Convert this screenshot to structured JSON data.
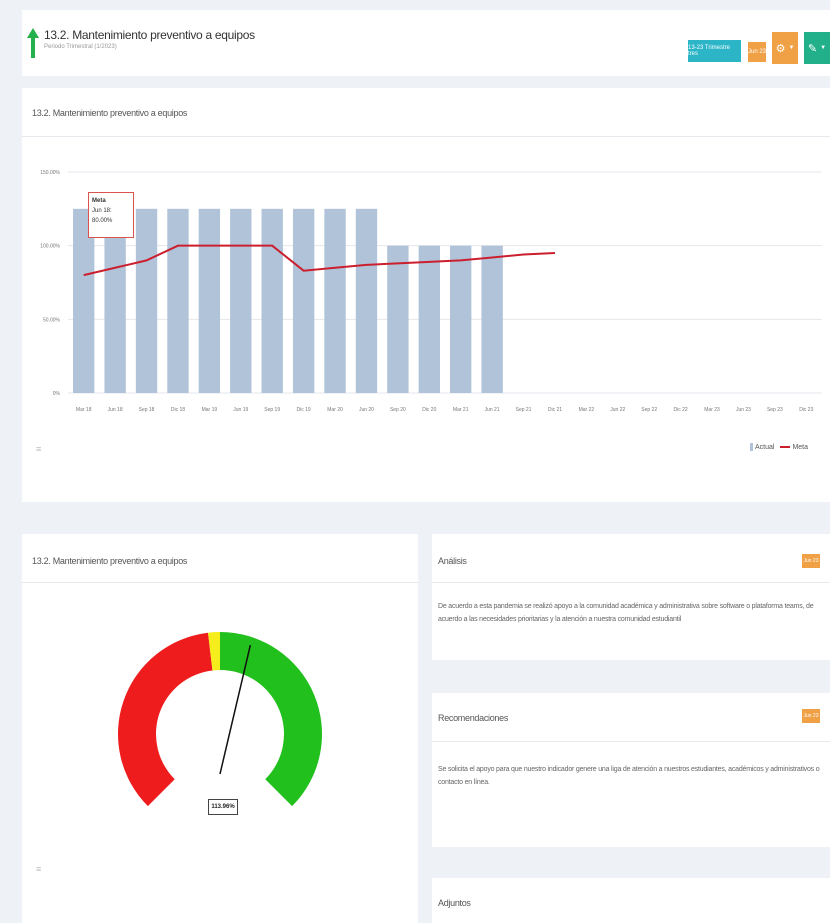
{
  "header": {
    "title": "13.2. Mantenimiento preventivo a equipos",
    "subtitle": "Periodo Trimestral (1/2023)",
    "period_button": "13-23 Trimestre tres",
    "lock_button": "Jun 23",
    "gear_icon": "gear-icon",
    "edit_icon": "pencil-icon",
    "accent_period": "#2bb5c7",
    "accent_orange": "#f0a045",
    "accent_green": "#22b08a"
  },
  "chart_card": {
    "title": "13.2. Mantenimiento preventivo a equipos",
    "legend": {
      "actual": "Actual",
      "meta": "Meta"
    },
    "tooltip": {
      "label": "Meta",
      "value": "Jun 18: 80.00%"
    }
  },
  "chart_data": {
    "type": "bar",
    "categories": [
      "Mar 18",
      "Jun 18",
      "Sep 18",
      "Dic 18",
      "Mar 19",
      "Jun 19",
      "Sep 19",
      "Dic 19",
      "Mar 20",
      "Jun 20",
      "Sep 20",
      "Dic 20",
      "Mar 21",
      "Jun 21",
      "Sep 21",
      "Dic 21",
      "Mar 22",
      "Jun 22",
      "Sep 22",
      "Dic 22",
      "Mar 23",
      "Jun 23",
      "Sep 23",
      "Dic 23"
    ],
    "series": [
      {
        "name": "Actual",
        "type": "bar",
        "color": "#b0c3d9",
        "values": [
          125,
          125,
          125,
          125,
          125,
          125,
          125,
          125,
          125,
          125,
          100,
          100,
          100,
          100,
          null,
          null,
          null,
          null,
          null,
          null,
          null,
          null,
          null,
          null
        ]
      },
      {
        "name": "Meta",
        "type": "line",
        "color": "#cc1f2e",
        "values": [
          80,
          85,
          90,
          100,
          100,
          100,
          100,
          83,
          85,
          87,
          88,
          89,
          90,
          92,
          94,
          95,
          null,
          null,
          null,
          null,
          null,
          null,
          null,
          null
        ]
      }
    ],
    "yticks": [
      "150.00%",
      "100.00%",
      "50.00%",
      "0%"
    ],
    "ylim": [
      0,
      150
    ],
    "grid": true,
    "legend_position": "bottom-right"
  },
  "gauge": {
    "title": "13.2. Mantenimiento preventivo a equipos",
    "value_label": "113.96%",
    "value": 113.96,
    "zones": [
      {
        "from": 0,
        "to": 95,
        "color": "#ee1c1c"
      },
      {
        "from": 95,
        "to": 100,
        "color": "#f5ee1c"
      },
      {
        "from": 100,
        "to": 200,
        "color": "#22c01c"
      }
    ],
    "min": 0,
    "max": 200
  },
  "analysis": {
    "title": "Análisis",
    "badge": "Jun 23",
    "text": "De acuerdo a esta pandemia se realizó apoyo a la comunidad académica y administrativa sobre software o plataforma teams, de acuerdo a las necesidades prioritarias y la atención a nuestra comunidad estudiantil"
  },
  "recommendations": {
    "title": "Recomendaciones",
    "badge": "Jun 23",
    "text": "Se solicita el apoyo para que nuestro indicador genere una liga de atención a nuestros estudiantes, académicos y administrativos o contacto en línea."
  },
  "attachments": {
    "title": "Adjuntos"
  }
}
